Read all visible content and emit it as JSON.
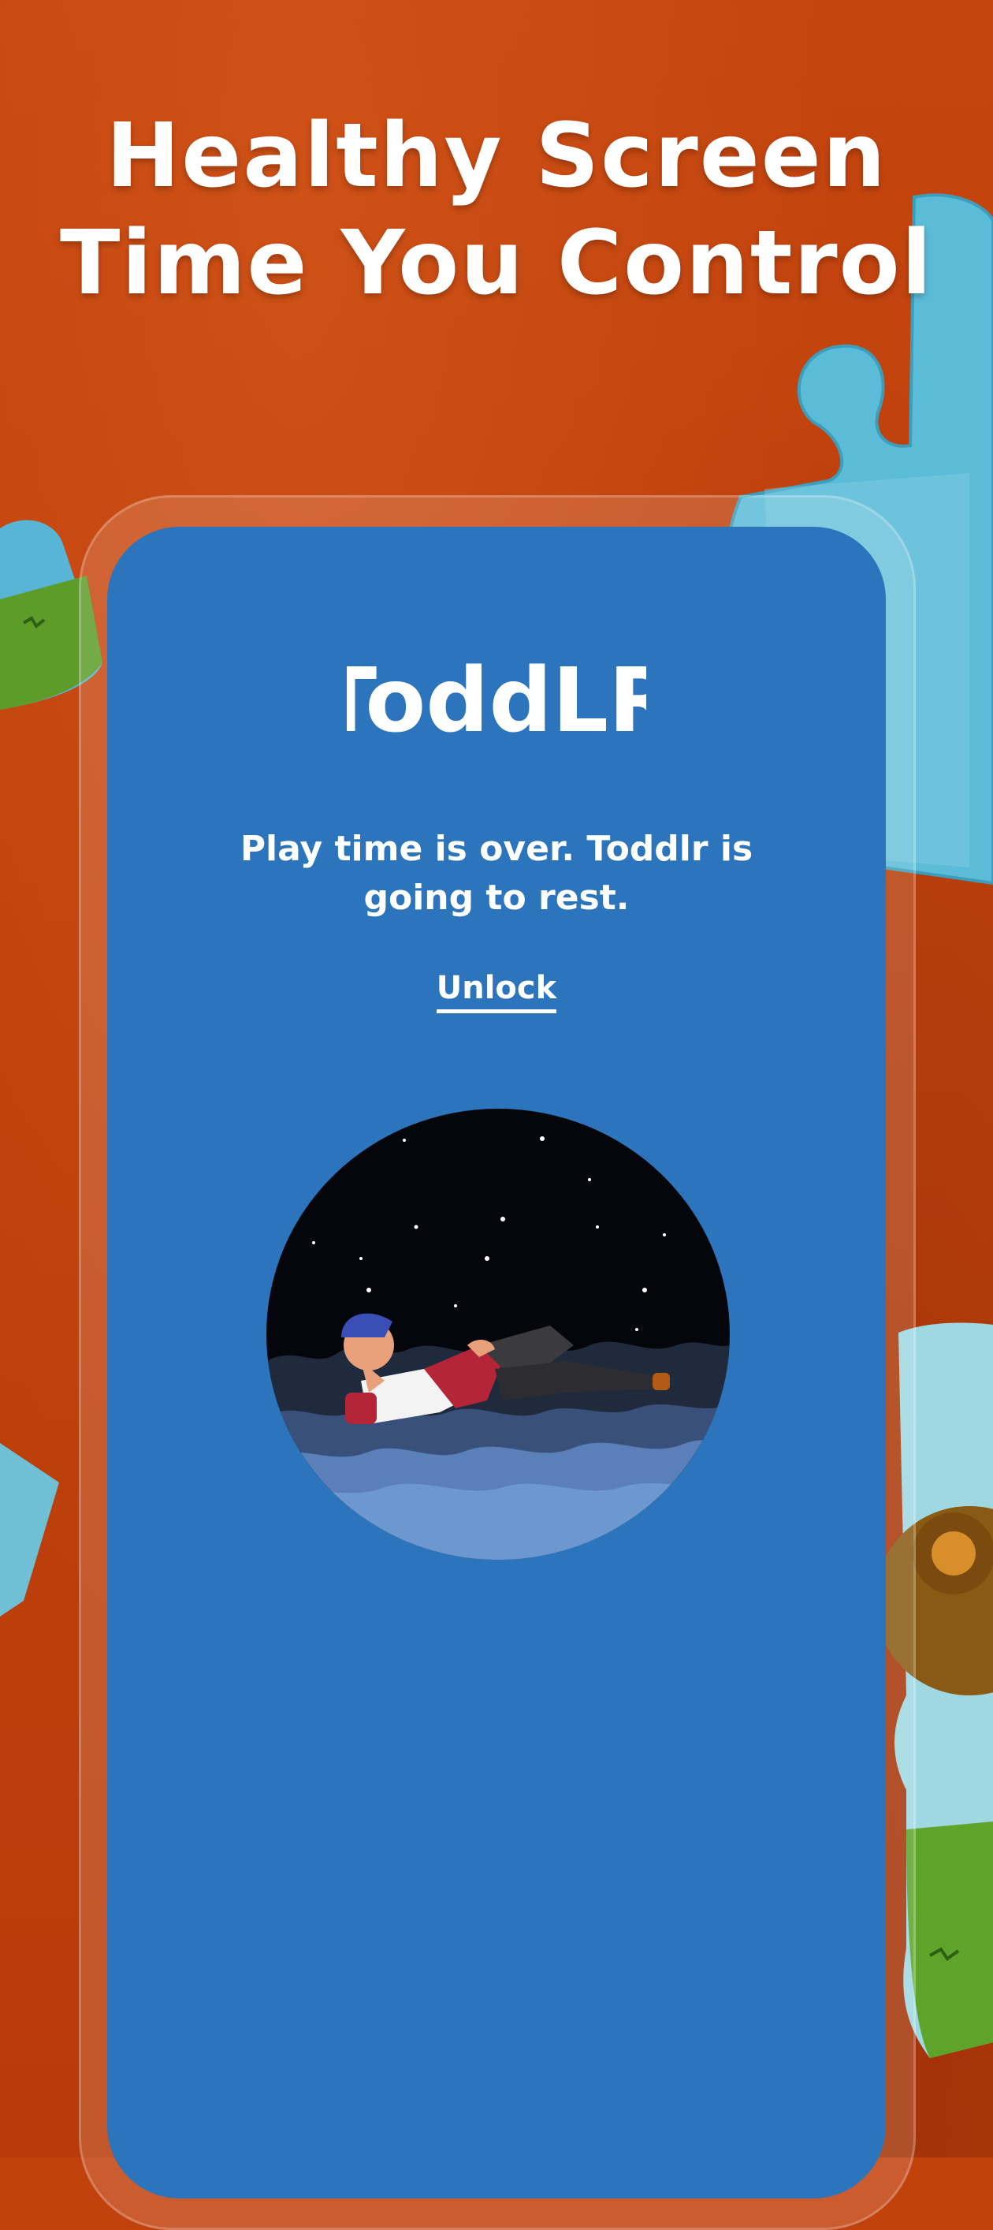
{
  "headline": {
    "line1": "Healthy Screen",
    "line2": "Time You Control"
  },
  "app": {
    "logo_text": "ToddLR",
    "message_line1": "Play time is over. Toddlr is",
    "message_line2": "going to rest.",
    "unlock_label": "Unlock"
  },
  "colors": {
    "background": "#c2420e",
    "screen": "#2c74bb",
    "text": "#ffffff"
  },
  "icons": [
    "sleeping-boy-illustration",
    "puzzle-piece-decoration",
    "teddy-bear-puzzle-decoration"
  ]
}
